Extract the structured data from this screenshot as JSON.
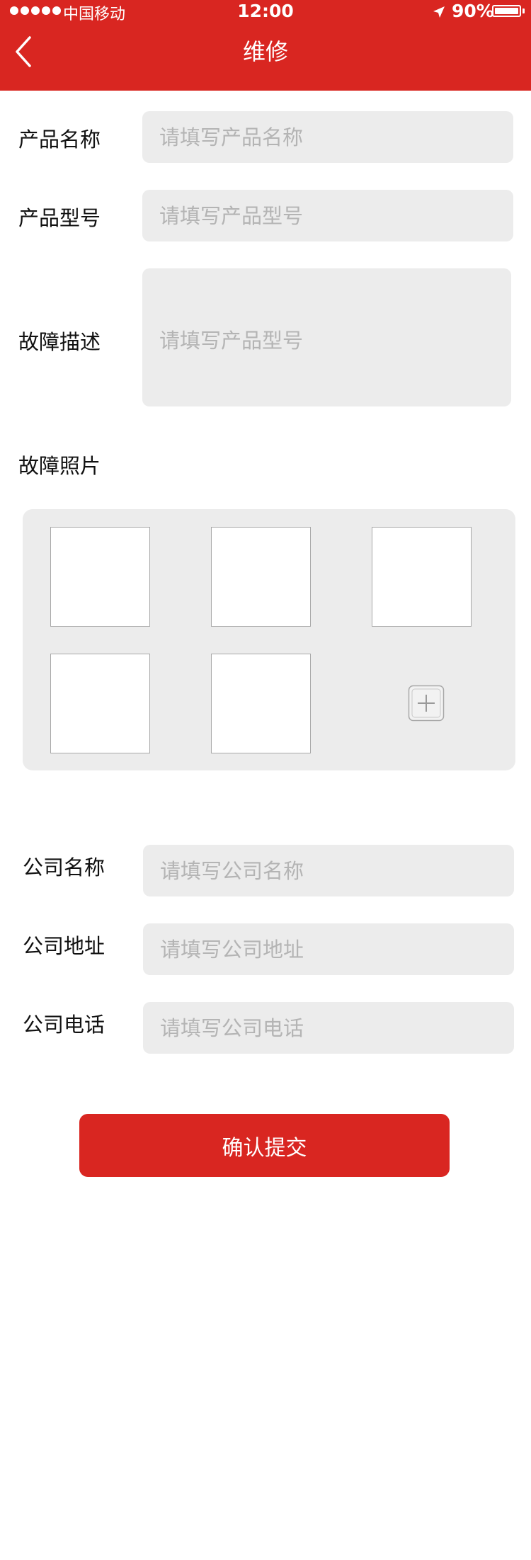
{
  "status_bar": {
    "carrier": "中国移动",
    "time": "12:00",
    "battery": "90%",
    "battery_level": 0.9
  },
  "header": {
    "title": "维修",
    "back_icon": "chevron-left-icon"
  },
  "form": {
    "product_name": {
      "label": "产品名称",
      "placeholder": "请填写产品名称",
      "value": ""
    },
    "product_model": {
      "label": "产品型号",
      "placeholder": "请填写产品型号",
      "value": ""
    },
    "fault_description": {
      "label": "故障描述",
      "placeholder": "请填写产品型号",
      "value": ""
    },
    "fault_photos": {
      "label": "故障照片",
      "photo_count": 5,
      "add_icon": "plus-icon"
    },
    "company_name": {
      "label": "公司名称",
      "placeholder": "请填写公司名称",
      "value": ""
    },
    "company_address": {
      "label": "公司地址",
      "placeholder": "请填写公司地址",
      "value": ""
    },
    "company_phone": {
      "label": "公司电话",
      "placeholder": "请填写公司电话",
      "value": ""
    }
  },
  "submit_label": "确认提交",
  "colors": {
    "primary": "#d92621",
    "field_background": "#ececec",
    "placeholder": "#b4b4b4",
    "text": "#111111",
    "background": "#ffffff"
  }
}
